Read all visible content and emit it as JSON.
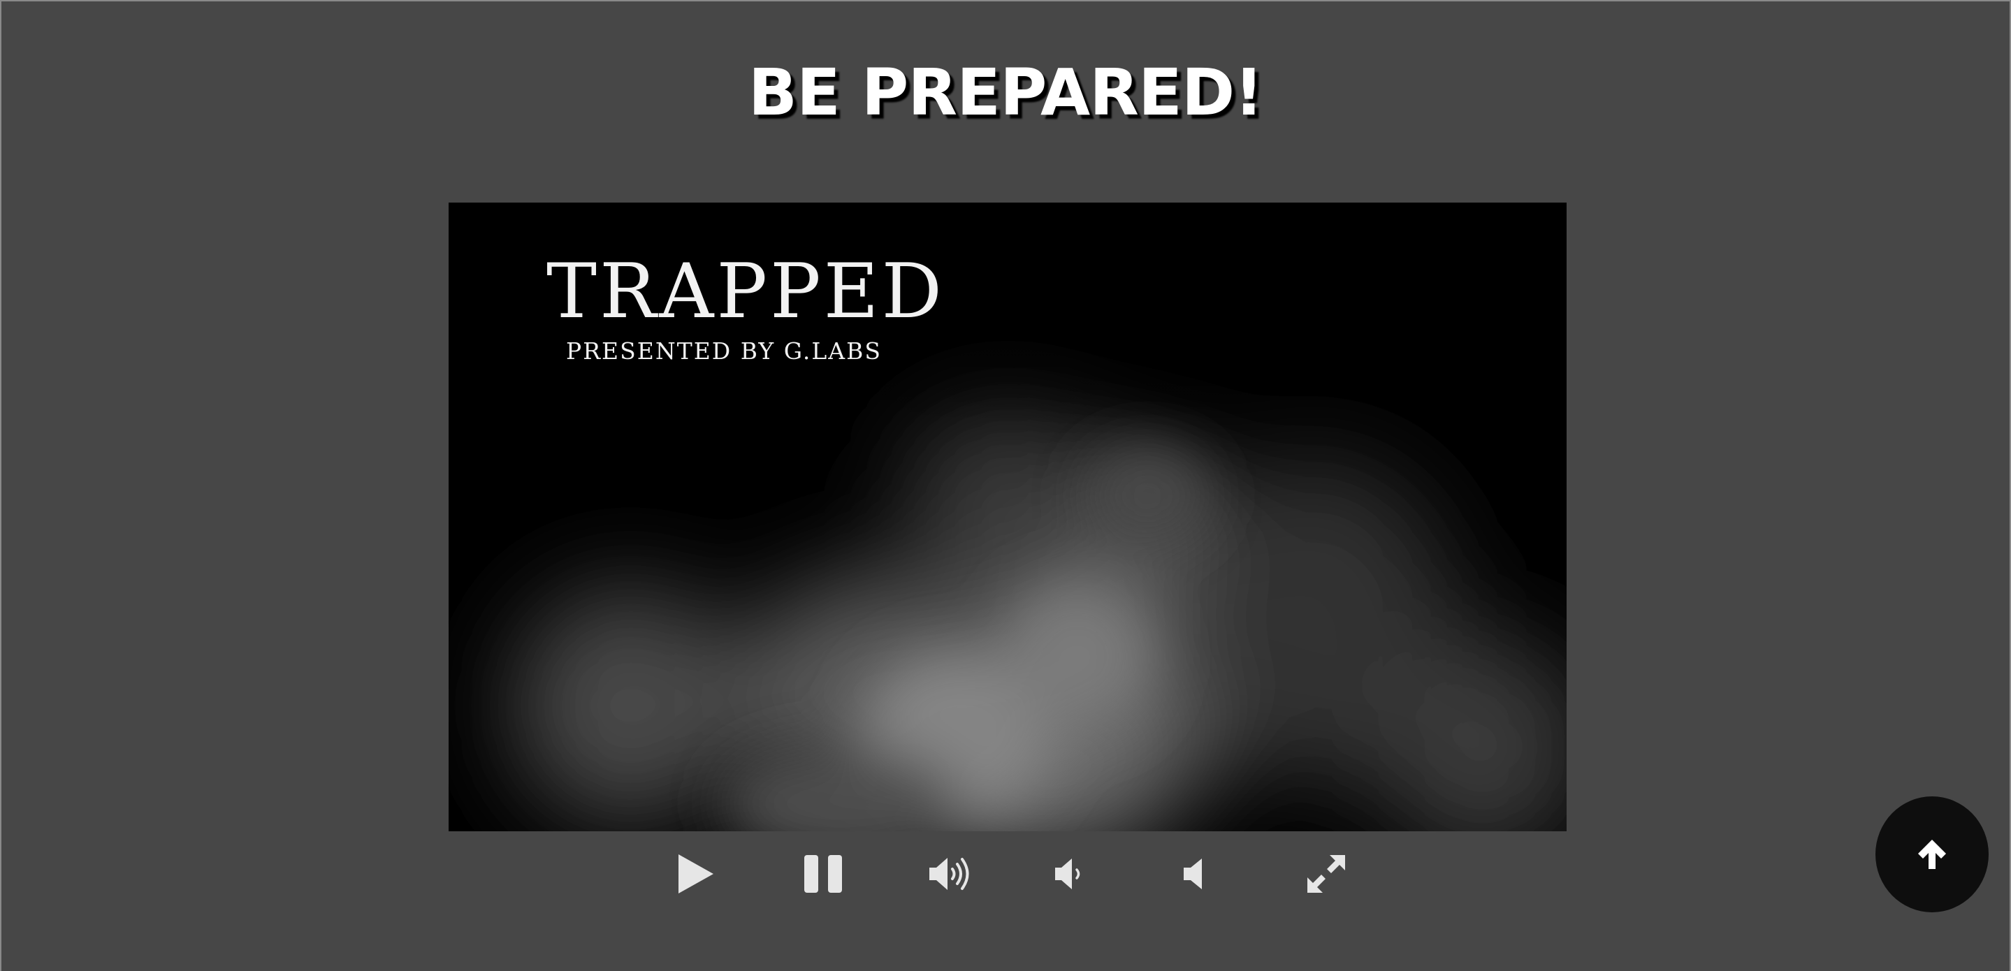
{
  "page": {
    "heading": "BE PREPARED!"
  },
  "video": {
    "title": "TRAPPED",
    "subtitle": "PRESENTED BY G.LABS"
  },
  "controls": [
    {
      "name": "play-button",
      "icon": "play-icon"
    },
    {
      "name": "pause-button",
      "icon": "pause-icon"
    },
    {
      "name": "volume-up-button",
      "icon": "volume-high-icon"
    },
    {
      "name": "volume-down-button",
      "icon": "volume-low-icon"
    },
    {
      "name": "mute-button",
      "icon": "volume-mute-icon"
    },
    {
      "name": "fullscreen-button",
      "icon": "expand-icon"
    }
  ],
  "scroll_top": {
    "icon": "arrow-up-icon"
  },
  "colors": {
    "page_background": "#474747",
    "video_background": "#000000",
    "icon": "#e6e6e6",
    "scroll_button": "#0e0e0e"
  }
}
